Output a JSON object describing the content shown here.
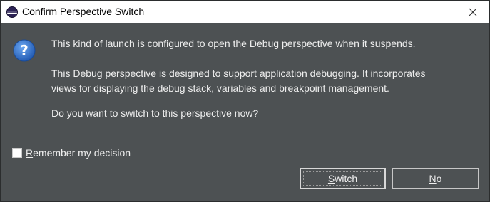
{
  "window": {
    "title": "Confirm Perspective Switch",
    "close_icon": "close-icon",
    "app_icon": "eclipse-icon"
  },
  "message": {
    "icon": "question-icon",
    "line1": "This kind of launch is configured to open the Debug perspective when it suspends.",
    "line2": "This Debug perspective is designed to support application debugging. It incorporates",
    "line3": "views for displaying the debug stack, variables and breakpoint management.",
    "line4": "Do you want to switch to this perspective now?"
  },
  "remember": {
    "label": "Remember my decision",
    "checked": false
  },
  "buttons": {
    "switch_label": "Switch",
    "no_label": "No"
  },
  "colors": {
    "background": "#4d5153",
    "titlebar": "#ffffff",
    "text": "#eeeeee",
    "icon_blue": "#2b6cc4"
  }
}
